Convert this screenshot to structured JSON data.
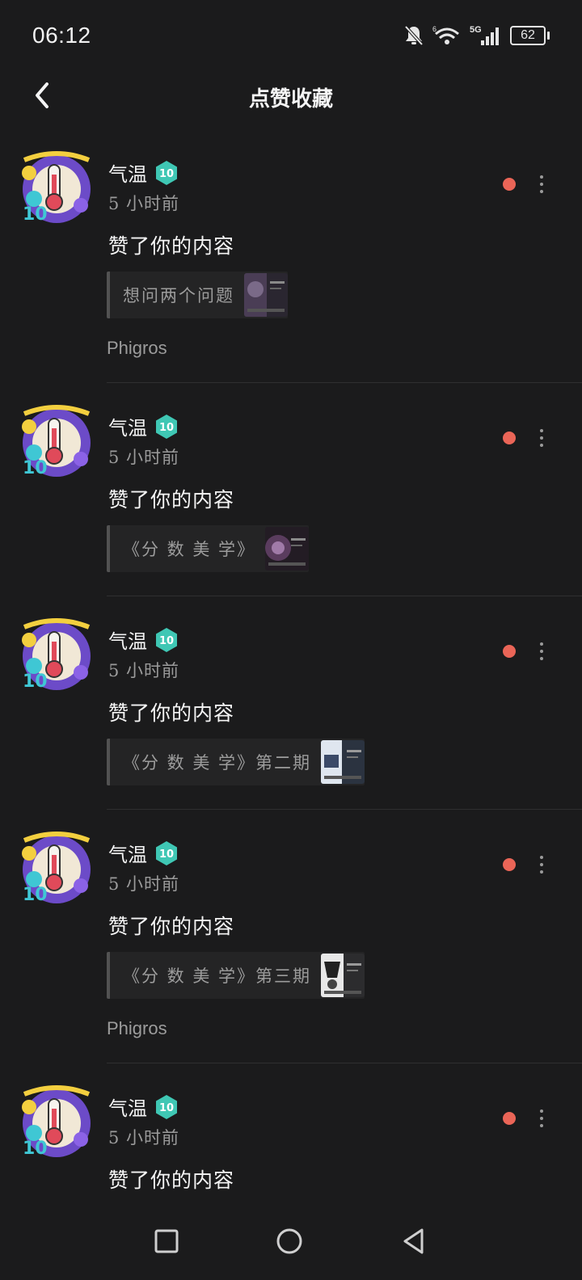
{
  "status_bar": {
    "time": "06:12",
    "battery_level": "62",
    "icons": [
      "bell-muted-icon",
      "wifi-icon",
      "signal-5g-icon",
      "battery-icon"
    ]
  },
  "header": {
    "title": "点赞收藏"
  },
  "colors": {
    "background": "#1b1b1c",
    "unread_dot": "#ea6557",
    "level_badge": "#3fc7b4"
  },
  "notifications": [
    {
      "user_name": "气温",
      "level": "10",
      "time_ago": "5 小时前",
      "action": "赞了你的内容",
      "quote": "想问两个问题",
      "tag": "Phigros",
      "unread": true
    },
    {
      "user_name": "气温",
      "level": "10",
      "time_ago": "5 小时前",
      "action": "赞了你的内容",
      "quote": "《分 数 美 学》",
      "tag": "",
      "unread": true
    },
    {
      "user_name": "气温",
      "level": "10",
      "time_ago": "5 小时前",
      "action": "赞了你的内容",
      "quote": "《分 数 美 学》第二期",
      "tag": "",
      "unread": true
    },
    {
      "user_name": "气温",
      "level": "10",
      "time_ago": "5 小时前",
      "action": "赞了你的内容",
      "quote": "《分 数 美 学》第三期",
      "tag": "Phigros",
      "unread": true
    },
    {
      "user_name": "气温",
      "level": "10",
      "time_ago": "5 小时前",
      "action": "赞了你的内容",
      "quote": "",
      "tag": "",
      "unread": true
    }
  ],
  "nav_bar": {
    "buttons": [
      "recent-apps-button",
      "home-button",
      "back-nav-button"
    ]
  }
}
